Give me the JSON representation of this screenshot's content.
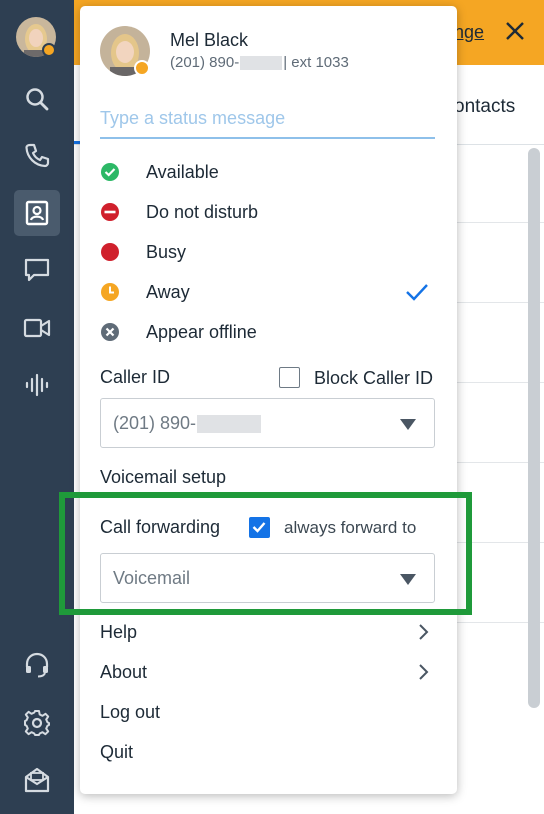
{
  "topbar": {
    "link_text": "nge"
  },
  "tabbar": {
    "visible_tab": "ontacts"
  },
  "profile": {
    "name": "Mel Black",
    "phone_prefix": "(201) 890-",
    "phone_suffix": "| ext 1033"
  },
  "status_input": {
    "placeholder": "Type a status message",
    "value": ""
  },
  "statuses": [
    {
      "label": "Available",
      "color": "#2cb866",
      "icon": "check-circle-icon"
    },
    {
      "label": "Do not disturb",
      "color": "#d0202c",
      "icon": "minus-circle-icon"
    },
    {
      "label": "Busy",
      "color": "#d0202c",
      "icon": "filled-circle-icon"
    },
    {
      "label": "Away",
      "color": "#f5a623",
      "icon": "clock-circle-icon",
      "selected": true
    },
    {
      "label": "Appear offline",
      "color": "#5f6b77",
      "icon": "x-circle-icon"
    }
  ],
  "caller_id": {
    "label": "Caller ID",
    "block_label": "Block Caller ID",
    "block_checked": false,
    "selected_prefix": "(201) 890-"
  },
  "voicemail": {
    "label": "Voicemail setup"
  },
  "call_forwarding": {
    "label": "Call forwarding",
    "always_label": "always forward to",
    "always_checked": true,
    "selected": "Voicemail"
  },
  "menu": {
    "help": "Help",
    "about": "About",
    "logout": "Log out",
    "quit": "Quit"
  },
  "colors": {
    "rail": "#2e3f52",
    "accent_orange": "#f5a623",
    "accent_blue": "#1473e6",
    "highlight_green": "#1f9a3a"
  }
}
